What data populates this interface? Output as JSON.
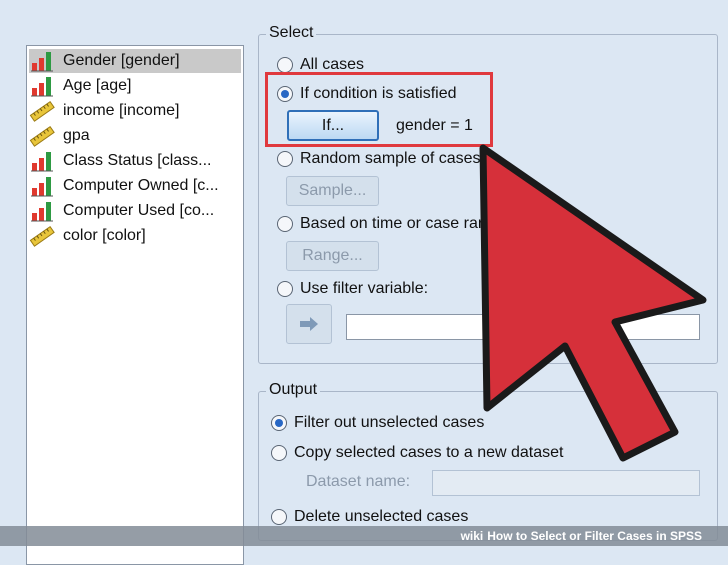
{
  "variables": [
    {
      "label": "Gender [gender]",
      "icon": "bar-chart-icon",
      "selected": true
    },
    {
      "label": "Age [age]",
      "icon": "bar-chart-icon",
      "selected": false
    },
    {
      "label": "income [income]",
      "icon": "ruler-icon",
      "selected": false
    },
    {
      "label": "gpa",
      "icon": "ruler-icon",
      "selected": false
    },
    {
      "label": "Class Status [class...",
      "icon": "bar-chart-icon",
      "selected": false
    },
    {
      "label": "Computer Owned [c...",
      "icon": "bar-chart-icon",
      "selected": false
    },
    {
      "label": "Computer Used [co...",
      "icon": "bar-chart-icon",
      "selected": false
    },
    {
      "label": "color [color]",
      "icon": "ruler-icon",
      "selected": false
    }
  ],
  "select": {
    "title": "Select",
    "all_cases": "All cases",
    "if_condition": "If condition is satisfied",
    "if_button": "If...",
    "condition": "gender = 1",
    "random_sample": "Random sample of cases",
    "sample_button": "Sample...",
    "based_on_time": "Based on time or case range",
    "range_button": "Range...",
    "use_filter": "Use filter variable:",
    "selected_option": "if_condition"
  },
  "output": {
    "title": "Output",
    "filter_out": "Filter out unselected cases",
    "copy_selected": "Copy selected cases to a new dataset",
    "dataset_name_label": "Dataset name:",
    "delete_unselected": "Delete unselected cases",
    "selected_option": "filter_out"
  },
  "footer": {
    "brand": "wiki",
    "title": "How to Select or Filter Cases in SPSS"
  },
  "colors": {
    "background": "#dce7f3",
    "highlight": "#e0393e",
    "arrow": "#d6303a",
    "radio_dot": "#2867c4"
  }
}
